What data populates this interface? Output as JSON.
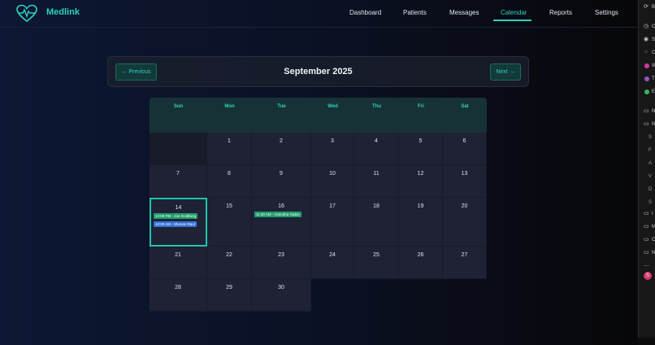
{
  "app": {
    "brand": "Medlink",
    "accent_color": "#2fd1bd",
    "logo_icon": "heart-pulse-icon"
  },
  "nav": {
    "items": [
      {
        "label": "Dashboard",
        "active": false
      },
      {
        "label": "Patients",
        "active": false
      },
      {
        "label": "Messages",
        "active": false
      },
      {
        "label": "Calendar",
        "active": true
      },
      {
        "label": "Reports",
        "active": false
      },
      {
        "label": "Settings",
        "active": false
      }
    ]
  },
  "calendar": {
    "prev_label": "← Previous",
    "next_label": "Next →",
    "month_title": "September 2025",
    "weekdays": [
      "Sun",
      "Mon",
      "Tue",
      "Wed",
      "Thu",
      "Fri",
      "Sat"
    ],
    "weeks": [
      [
        "",
        "1",
        "2",
        "3",
        "4",
        "5",
        "6"
      ],
      [
        "7",
        "8",
        "9",
        "10",
        "11",
        "12",
        "13"
      ],
      [
        "14",
        "15",
        "16",
        "17",
        "18",
        "19",
        "20"
      ],
      [
        "21",
        "22",
        "23",
        "24",
        "25",
        "26",
        "27"
      ],
      [
        "28",
        "29",
        "30",
        "",
        "",
        "",
        ""
      ]
    ],
    "selected_day": "14",
    "appointments": [
      {
        "day": "14",
        "text": "12:00 PM - Joe Goldberg",
        "color": "#1f9d6b"
      },
      {
        "day": "14",
        "text": "10:00 AM - Shovan Raut",
        "color": "#3572d6"
      },
      {
        "day": "16",
        "text": "11:30 AM - Anirusha Yadav",
        "color": "#1f9d6b"
      }
    ]
  },
  "sidebar": {
    "rows": [
      {
        "icon": "refresh-icon",
        "glyph": "⟳",
        "text": "B"
      },
      {
        "icon": "clock-icon",
        "glyph": "◷",
        "text": "C"
      },
      {
        "icon": "target-icon",
        "glyph": "◉",
        "text": "S"
      },
      {
        "icon": "grid-icon",
        "glyph": "⁘",
        "text": "C"
      },
      {
        "icon": "pink-app-icon",
        "dot": "#d6369e",
        "text": "W"
      },
      {
        "icon": "globe-icon",
        "dot": "#8e57c9",
        "text": "T"
      },
      {
        "icon": "multicolor-app-icon",
        "dot": "#3db560",
        "text": "E"
      },
      {
        "icon": "folder-icon",
        "glyph": "▭",
        "text": "N"
      },
      {
        "icon": "folder-open-icon",
        "glyph": "▭",
        "text": "N"
      }
    ],
    "indented": [
      "S",
      "F",
      "A",
      "V",
      "D",
      "S"
    ],
    "rows_bottom": [
      {
        "icon": "folder-icon",
        "glyph": "▭",
        "text": "I"
      },
      {
        "icon": "folder-icon",
        "glyph": "▭",
        "text": "M"
      },
      {
        "icon": "folder-icon",
        "glyph": "▭",
        "text": "C"
      },
      {
        "icon": "folder-icon",
        "glyph": "▭",
        "text": "N"
      },
      {
        "icon": "more-icon",
        "glyph": "…",
        "text": ""
      }
    ],
    "avatar_letter": "S",
    "avatar_color": "#d4366c"
  }
}
